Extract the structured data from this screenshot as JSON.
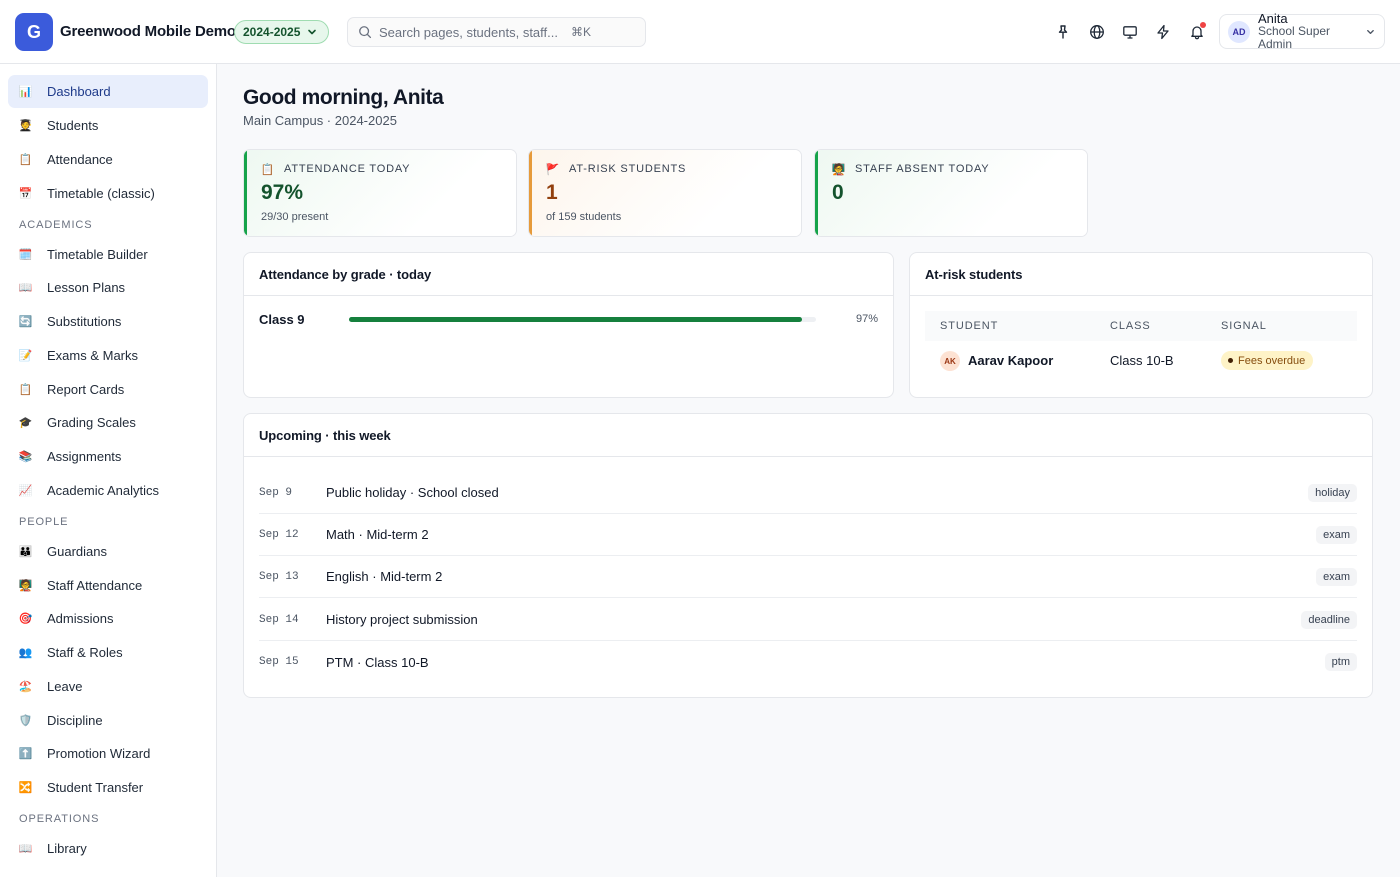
{
  "app": {
    "logo_letter": "G",
    "name": "Greenwood Mobile Demo",
    "year": "2024-2025"
  },
  "search": {
    "placeholder": "Search pages, students, staff...",
    "shortcut": "⌘K"
  },
  "user": {
    "initials": "AD",
    "name": "Anita",
    "role": "School Super Admin"
  },
  "sidebar": {
    "items": [
      {
        "label": "Dashboard",
        "icon": "bar-chart",
        "emoji": "📊",
        "active": true
      },
      {
        "label": "Students",
        "icon": "student",
        "emoji": "🧑‍🎓"
      },
      {
        "label": "Attendance",
        "icon": "clipboard",
        "emoji": "📋"
      },
      {
        "label": "Timetable (classic)",
        "icon": "calendar",
        "emoji": "📅"
      }
    ],
    "academics_title": "ACADEMICS",
    "academics": [
      {
        "label": "Timetable Builder",
        "icon": "calendar-tear",
        "emoji": "🗓️"
      },
      {
        "label": "Lesson Plans",
        "icon": "open-book",
        "emoji": "📖"
      },
      {
        "label": "Substitutions",
        "icon": "cycle",
        "emoji": "🔄"
      },
      {
        "label": "Exams & Marks",
        "icon": "memo",
        "emoji": "📝"
      },
      {
        "label": "Report Cards",
        "icon": "report",
        "emoji": "📋"
      },
      {
        "label": "Grading Scales",
        "icon": "grad-cap",
        "emoji": "🎓"
      },
      {
        "label": "Assignments",
        "icon": "books",
        "emoji": "📚"
      },
      {
        "label": "Academic Analytics",
        "icon": "trend",
        "emoji": "📈"
      }
    ],
    "people_title": "PEOPLE",
    "people": [
      {
        "label": "Guardians",
        "icon": "family",
        "emoji": "👪"
      },
      {
        "label": "Staff Attendance",
        "icon": "teacher",
        "emoji": "🧑‍🏫"
      },
      {
        "label": "Admissions",
        "icon": "target",
        "emoji": "🎯"
      },
      {
        "label": "Staff & Roles",
        "icon": "people",
        "emoji": "👥"
      },
      {
        "label": "Leave",
        "icon": "beach",
        "emoji": "🏖️"
      },
      {
        "label": "Discipline",
        "icon": "shield",
        "emoji": "🛡️"
      },
      {
        "label": "Promotion Wizard",
        "icon": "up-arrow",
        "emoji": "⬆️"
      },
      {
        "label": "Student Transfer",
        "icon": "transfer",
        "emoji": "🔀"
      }
    ],
    "operations_title": "OPERATIONS",
    "operations": [
      {
        "label": "Library",
        "icon": "book",
        "emoji": "📖"
      }
    ]
  },
  "greeting": {
    "title": "Good morning, Anita",
    "subtitle": "Main Campus · 2024-2025"
  },
  "stats": [
    {
      "label": "ATTENDANCE TODAY",
      "emoji": "📋",
      "value": "97%",
      "sub": "29/30 present",
      "color": "#15803d"
    },
    {
      "label": "AT-RISK STUDENTS",
      "emoji": "🚩",
      "value": "1",
      "sub": "of 159 students",
      "color": "#d97706"
    },
    {
      "label": "STAFF ABSENT TODAY",
      "emoji": "🧑‍🏫",
      "value": "0",
      "sub": "",
      "color": "#15803d"
    }
  ],
  "attendance_by_grade": {
    "title": "Attendance by grade · today",
    "rows": [
      {
        "grade": "Class 9",
        "pct_label": "97%",
        "fraction": 0.97
      }
    ]
  },
  "at_risk": {
    "title": "At-risk students",
    "columns": [
      "STUDENT",
      "CLASS",
      "SIGNAL"
    ],
    "rows": [
      {
        "initials": "AK",
        "name": "Aarav Kapoor",
        "class": "Class 10-B",
        "signal": "Fees overdue"
      }
    ]
  },
  "upcoming": {
    "title": "Upcoming · this week",
    "events": [
      {
        "date": "Sep 9",
        "title": "Public holiday · School closed",
        "tag": "holiday"
      },
      {
        "date": "Sep 12",
        "title": "Math · Mid-term 2",
        "tag": "exam"
      },
      {
        "date": "Sep 13",
        "title": "English · Mid-term 2",
        "tag": "exam"
      },
      {
        "date": "Sep 14",
        "title": "History project submission",
        "tag": "deadline"
      },
      {
        "date": "Sep 15",
        "title": "PTM · Class 10-B",
        "tag": "ptm"
      }
    ]
  }
}
